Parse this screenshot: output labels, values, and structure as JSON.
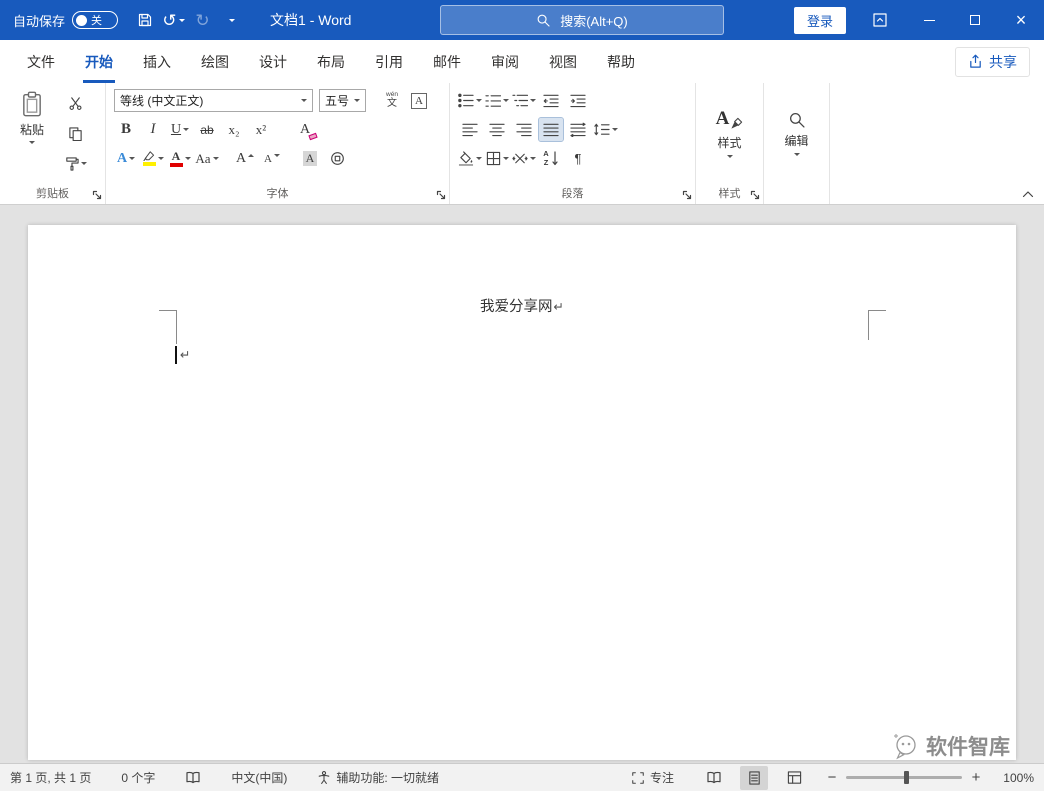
{
  "window": {
    "autosave_label": "自动保存",
    "autosave_state": "关",
    "title": "文档1 - Word",
    "search_text": "搜索(Alt+Q)",
    "signin": "登录"
  },
  "tabs": {
    "items": [
      "文件",
      "开始",
      "插入",
      "绘图",
      "设计",
      "布局",
      "引用",
      "邮件",
      "审阅",
      "视图",
      "帮助"
    ],
    "share": "共享"
  },
  "ribbon": {
    "clipboard": {
      "label": "剪贴板",
      "paste": "粘贴"
    },
    "font": {
      "label": "字体",
      "name": "等线 (中文正文)",
      "size": "五号",
      "bold": "B",
      "italic": "I",
      "underline": "U",
      "strikethrough": "ab",
      "subscript": "x₂",
      "superscript": "x²",
      "clear_format": "A",
      "text_effects": "A",
      "font_color": "A",
      "change_case": "Aa",
      "grow_font": "A",
      "shrink_font": "A",
      "char_shading": "A",
      "char_border": "A",
      "phonetic_top": "wén",
      "phonetic_bottom": "文"
    },
    "paragraph": {
      "label": "段落"
    },
    "styles": {
      "label": "样式",
      "button": "样式",
      "icon_letter": "A"
    },
    "editing": {
      "button": "编辑"
    }
  },
  "document": {
    "header_text": "我爱分享网",
    "paragraph_mark": "↵"
  },
  "watermark": {
    "text": "软件智库"
  },
  "status": {
    "page_info": "第 1 页, 共 1 页",
    "word_count": "0 个字",
    "language": "中文(中国)",
    "accessibility": "辅助功能: 一切就绪",
    "focus": "专注",
    "zoom": "100%"
  },
  "glyphs": {
    "undo": "↺",
    "redo": "↻",
    "close": "×",
    "zoom_out": "−",
    "zoom_in": "+",
    "pilcrow": "¶",
    "sort_a": "A",
    "sort_z": "Z"
  },
  "colors": {
    "titlebar": "#185ABD",
    "accent": "#185ABD",
    "highlight_yellow": "#FFF000",
    "font_color_red": "#E00000"
  }
}
